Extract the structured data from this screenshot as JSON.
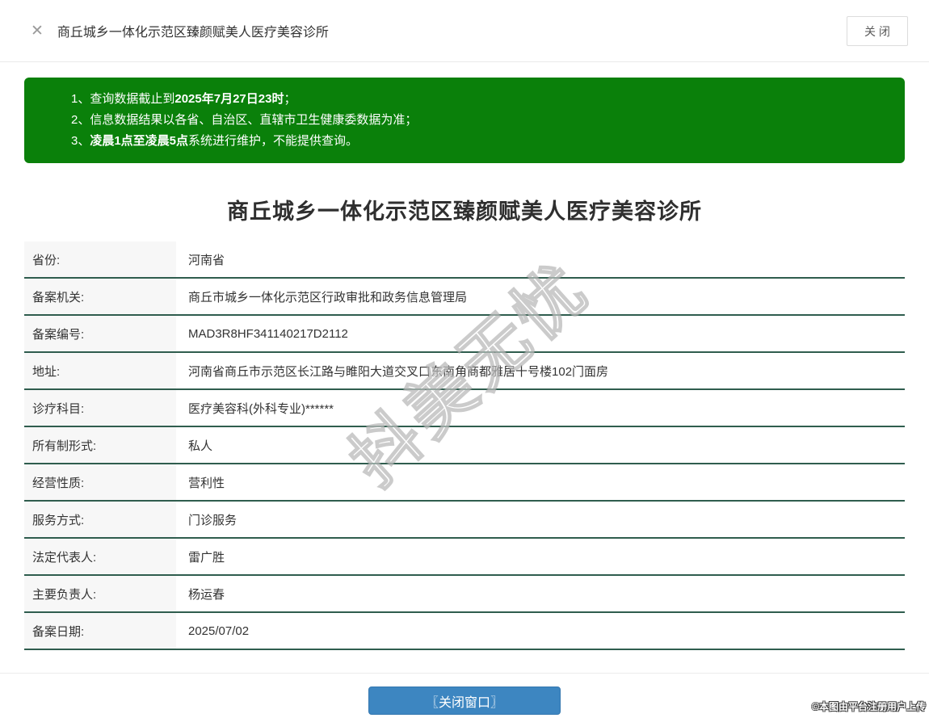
{
  "window": {
    "close_x": "✕",
    "title": "商丘城乡一体化示范区臻颜赋美人医疗美容诊所",
    "close_button_label": "关 闭"
  },
  "notice": {
    "lines": [
      {
        "num": "1、",
        "pre": "查询数据截止到",
        "bold": "2025年7月27日23时",
        "post": "；"
      },
      {
        "num": "2、",
        "pre": "信息数据结果以各省、自治区、直辖市卫生健康委数据为准；",
        "bold": "",
        "post": ""
      },
      {
        "num": "3、",
        "pre": "",
        "bold": "凌晨1点至凌晨5点",
        "post": "系统进行维护，不能提供查询。"
      }
    ]
  },
  "page": {
    "title": "商丘城乡一体化示范区臻颜赋美人医疗美容诊所"
  },
  "table": {
    "rows": [
      {
        "label": "省份:",
        "value": "河南省"
      },
      {
        "label": "备案机关:",
        "value": "商丘市城乡一体化示范区行政审批和政务信息管理局"
      },
      {
        "label": "备案编号:",
        "value": "MAD3R8HF341140217D2112"
      },
      {
        "label": "地址:",
        "value": "河南省商丘市示范区长江路与睢阳大道交叉口东南角商都雅居十号楼102门面房"
      },
      {
        "label": "诊疗科目:",
        "value": "医疗美容科(外科专业)******"
      },
      {
        "label": "所有制形式:",
        "value": "私人"
      },
      {
        "label": "经营性质:",
        "value": "营利性"
      },
      {
        "label": "服务方式:",
        "value": "门诊服务"
      },
      {
        "label": "法定代表人:",
        "value": "雷广胜"
      },
      {
        "label": "主要负责人:",
        "value": "杨运春"
      },
      {
        "label": "备案日期:",
        "value": "2025/07/02"
      }
    ]
  },
  "footer": {
    "close_window_button": "〖关闭窗口〗",
    "credit": "©本图由平台注册用户上传"
  },
  "watermark": {
    "text": "抖美无忧"
  },
  "colors": {
    "notice_green": "#0a800a",
    "row_divider_green": "#2f5d4e",
    "button_blue": "#3d86c1",
    "label_cell_bg": "#f7f7f7"
  }
}
